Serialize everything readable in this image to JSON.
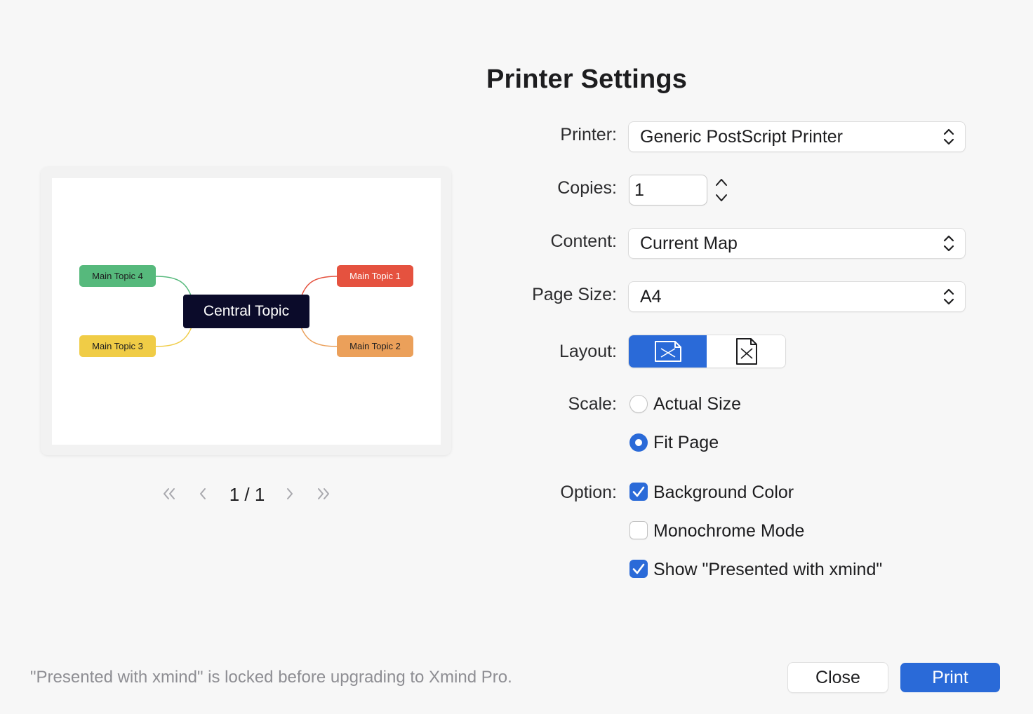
{
  "dialog": {
    "title": "Printer Settings"
  },
  "preview": {
    "central": "Central Topic",
    "topics": [
      "Main Topic 1",
      "Main Topic 2",
      "Main Topic 3",
      "Main Topic 4"
    ],
    "colors": {
      "topic1": "#e5523f",
      "topic2": "#eba05a",
      "topic3": "#f0cc46",
      "topic4": "#56b97c",
      "central": "#0b0b2a"
    }
  },
  "pager": {
    "first": "«",
    "prev": "‹",
    "page": "1 / 1",
    "next": "›",
    "last": "»"
  },
  "form": {
    "printer": {
      "label": "Printer:",
      "value": "Generic PostScript Printer"
    },
    "copies": {
      "label": "Copies:",
      "value": "1"
    },
    "content": {
      "label": "Content:",
      "value": "Current Map"
    },
    "page_size": {
      "label": "Page Size:",
      "value": "A4"
    },
    "layout": {
      "label": "Layout:",
      "options": [
        "landscape",
        "portrait"
      ],
      "selected": "landscape"
    },
    "scale": {
      "label": "Scale:",
      "options": [
        {
          "label": "Actual Size",
          "selected": false
        },
        {
          "label": "Fit Page",
          "selected": true
        }
      ]
    },
    "option": {
      "label": "Option:",
      "items": [
        {
          "label": "Background Color",
          "checked": true
        },
        {
          "label": "Monochrome Mode",
          "checked": false
        },
        {
          "label": "Show \"Presented with xmind\"",
          "checked": true
        }
      ]
    }
  },
  "footer": {
    "note": "\"Presented with xmind\" is locked before upgrading to Xmind Pro.",
    "close_label": "Close",
    "print_label": "Print"
  },
  "accent_color": "#2a6ad8"
}
